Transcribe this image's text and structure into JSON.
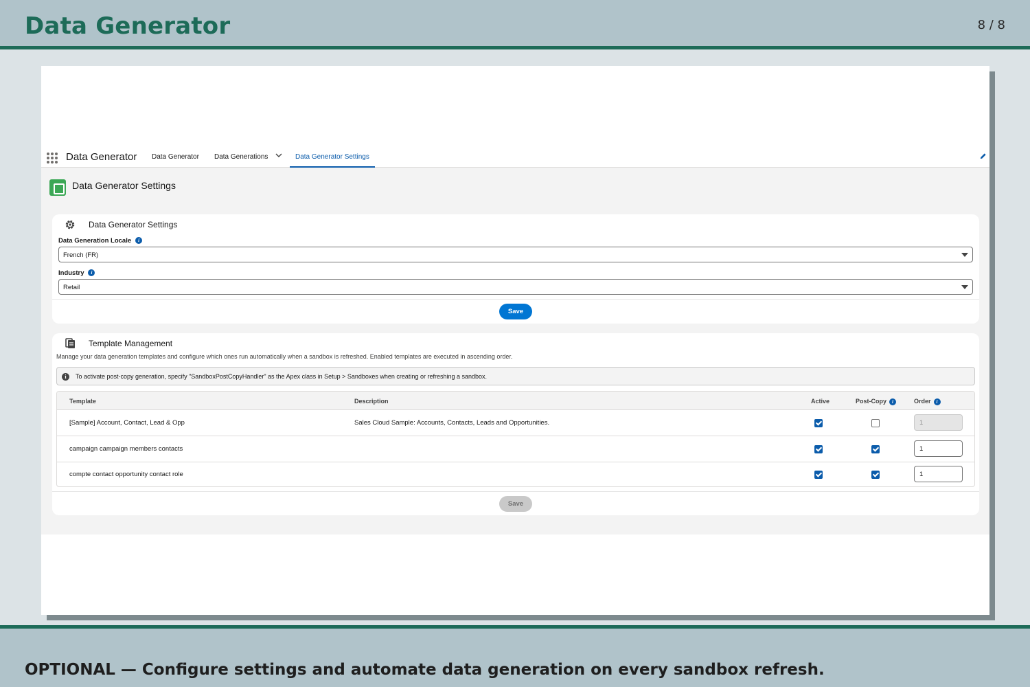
{
  "slide": {
    "title": "Data Generator",
    "page": "8 / 8",
    "caption": "OPTIONAL — Configure settings and automate data generation on every sandbox refresh."
  },
  "app": {
    "name": "Data Generator",
    "nav": [
      {
        "label": "Data Generator",
        "active": false
      },
      {
        "label": "Data Generations",
        "active": false,
        "has_dropdown": true
      },
      {
        "label": "Data Generator Settings",
        "active": true
      }
    ],
    "page_title": "Data Generator Settings"
  },
  "settings_card": {
    "title": "Data Generator Settings",
    "locale_label": "Data Generation Locale",
    "locale_value": "French (FR)",
    "industry_label": "Industry",
    "industry_value": "Retail",
    "save_label": "Save"
  },
  "template_card": {
    "title": "Template Management",
    "description": "Manage your data generation templates and configure which ones run automatically when a sandbox is refreshed. Enabled templates are executed in ascending order.",
    "notice": "To activate post-copy generation, specify \"SandboxPostCopyHandler\" as the Apex class in Setup > Sandboxes when creating or refreshing a sandbox.",
    "columns": [
      "Template",
      "Description",
      "Active",
      "Post-Copy",
      "Order"
    ],
    "rows": [
      {
        "template": "[Sample] Account, Contact, Lead & Opp",
        "description": "Sales Cloud Sample: Accounts, Contacts, Leads and Opportunities.",
        "active": true,
        "post_copy": false,
        "order": "1",
        "order_disabled": true
      },
      {
        "template": "campaign campaign members contacts",
        "description": "",
        "active": true,
        "post_copy": true,
        "order": "1",
        "order_disabled": false
      },
      {
        "template": "compte contact opportunity contact role",
        "description": "",
        "active": true,
        "post_copy": true,
        "order": "1",
        "order_disabled": false
      }
    ],
    "save_label": "Save"
  },
  "colors": {
    "brand_green": "#1d6b58",
    "header_bg": "#b0c3ca",
    "salesforce_blue": "#0176d3",
    "checkbox_blue": "#0b5cab"
  },
  "icons": [
    "app-launcher-icon",
    "chevron-down-icon",
    "edit-icon",
    "settings-page-icon",
    "gear-icon",
    "document-icon",
    "info-icon"
  ]
}
